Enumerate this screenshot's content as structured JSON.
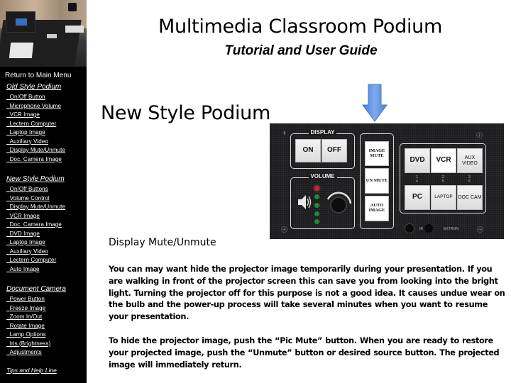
{
  "header": {
    "title": "Multimedia Classroom Podium",
    "subtitle": "Tutorial and User Guide"
  },
  "sidebar": {
    "photo_alt": "podium-photo",
    "return_label": "Return to Main Menu",
    "sections": [
      {
        "title": "Old Style Podium",
        "items": [
          "On/Off Button",
          "Microphone Volume",
          "VCR Image",
          "Lectern Computer",
          "Laptop Image",
          "Auxiliary Video",
          "Display Mute/Unmute",
          "Doc. Camera Image"
        ]
      },
      {
        "title": "New Style Podium",
        "items": [
          "On/Off Buttons",
          "Volume Control",
          "Display Mute/Unmute",
          "VCR Image",
          "Doc. Camera Image",
          "DVD Image",
          "Laptop Image",
          "Auxiliary Video",
          "Lectern Computer",
          "Auto Image"
        ]
      },
      {
        "title": "Document Camera",
        "items": [
          "Power Button",
          "Freeze Image",
          "Zoom In/Out",
          "Rotate Image",
          "Lamp Options",
          "Iris (Brightness)",
          "Adjustments"
        ]
      }
    ],
    "tips_label": "Tips and Help Line"
  },
  "main": {
    "section_title": "New Style Podium",
    "arrow_icon": "down-arrow",
    "arrow_color": "#5b8fd9",
    "panel": {
      "display_label": "DISPLAY",
      "display_on": "ON",
      "display_off": "OFF",
      "volume_label": "VOLUME",
      "image_mute": "IMAGE MUTE",
      "un_mute": "UN MUTE",
      "auto_image": "AUTO IMAGE",
      "sources": [
        "DVD",
        "VCR",
        "AUX VIDEO",
        "PC",
        "LAPTOP",
        "DOC CAM"
      ],
      "source_numbers_top": [
        "1",
        "2",
        "3"
      ],
      "source_numbers_bottom": [
        "4",
        "5",
        "6"
      ],
      "ir_label": "IR",
      "brand_label": "EXTRON"
    },
    "topic_title": "Display Mute/Unmute",
    "paragraphs": [
      "You can may want hide the projector image temporarily during your presentation. If you are walking in front of the projector screen this can save you from looking into the bright light. Turning the projector off for this purpose is not a good idea. It causes undue wear on the bulb and the power-up process will take several minutes when you want to resume your presentation.",
      "To hide the projector image, push the “Pic Mute” button. When you are ready to restore your projected image, push the “Unmute” button or desired source button. The projected image will immediately return."
    ]
  }
}
